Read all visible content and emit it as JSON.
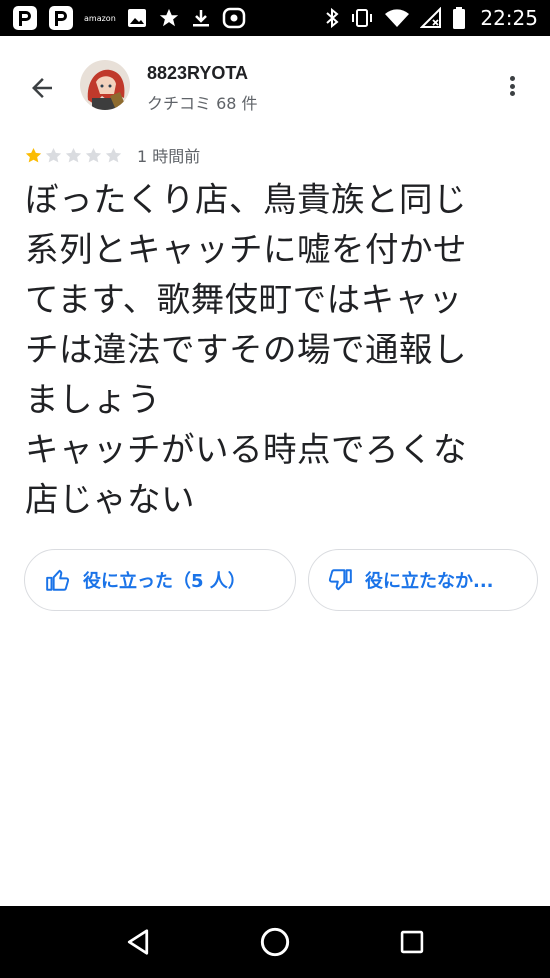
{
  "status_bar": {
    "time": "22:25",
    "left_icons": [
      "paypay-icon",
      "paypay-icon",
      "amazon-icon",
      "image-icon",
      "star-icon",
      "download-icon",
      "link-icon"
    ],
    "amazon_label": "amazon",
    "right_icons": [
      "bluetooth-icon",
      "vibrate-icon",
      "wifi-icon",
      "no-signal-icon",
      "battery-icon"
    ]
  },
  "header": {
    "user_name": "8823RYOTA",
    "review_count": "クチコミ 68 件"
  },
  "review": {
    "rating": 1,
    "max_rating": 5,
    "time_ago": "1 時間前",
    "text": "ぼったくり店、鳥貴族と同じ\n系列とキャッチに嘘を付かせ\nてます、歌舞伎町ではキャッ\nチは違法ですその場で通報し\nましょう\nキャッチがいる時点でろくな\n店じゃない"
  },
  "actions": {
    "helpful_label": "役に立った（5 人）",
    "not_helpful_label": "役に立たなか..."
  },
  "colors": {
    "accent": "#1a73e8",
    "star_filled": "#fbbc04",
    "star_empty": "#dadce0",
    "secondary_text": "#5f6368"
  }
}
